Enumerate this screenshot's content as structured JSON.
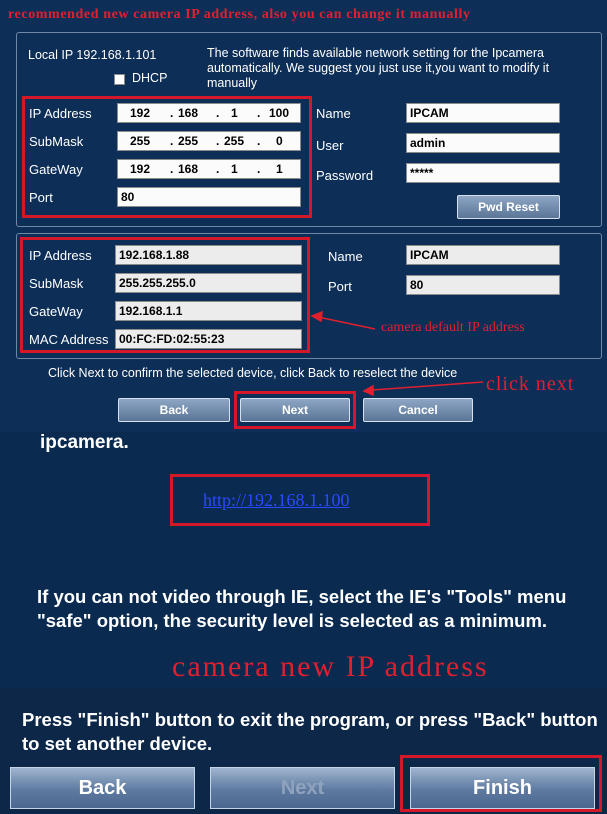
{
  "annotations": {
    "recommended": "recommended new camera IP address, also you can change it manually",
    "default_ip": "camera default IP address",
    "click_next": "click next",
    "new_ip": "camera new IP address"
  },
  "network": {
    "local_ip": "Local IP 192.168.1.101",
    "dhcp_label": "DHCP",
    "hint": "The software finds available network setting for the Ipcamera automatically. We suggest you just use it,you want to modify it manually"
  },
  "new_settings": {
    "ip_label": "IP Address",
    "ip": [
      "192",
      "168",
      "1",
      "100"
    ],
    "mask_label": "SubMask",
    "mask": [
      "255",
      "255",
      "255",
      "0"
    ],
    "gateway_label": "GateWay",
    "gateway": [
      "192",
      "168",
      "1",
      "1"
    ],
    "port_label": "Port",
    "port": "80",
    "name_label": "Name",
    "name": "IPCAM",
    "user_label": "User",
    "user": "admin",
    "password_label": "Password",
    "password": "*****",
    "pwd_reset": "Pwd Reset"
  },
  "default_settings": {
    "ip_label": "IP Address",
    "ip": "192.168.1.88",
    "mask_label": "SubMask",
    "mask": "255.255.255.0",
    "gateway_label": "GateWay",
    "gateway": "192.168.1.1",
    "mac_label": "MAC Address",
    "mac": "00:FC:FD:02:55:23",
    "name_label": "Name",
    "name": "IPCAM",
    "port_label": "Port",
    "port": "80"
  },
  "wizard": {
    "instruction": "Click Next to confirm the selected device, click Back to reselect the device",
    "back": "Back",
    "next": "Next",
    "cancel": "Cancel"
  },
  "finish_page": {
    "heading": "ipcamera.",
    "link": "http://192.168.1.100",
    "ie_note": "If you can not video through IE, select the IE's \"Tools\" menu \"safe\" option, the security level is selected as a minimum.",
    "finish_note": "Press \"Finish\" button to exit the program, or press \"Back\" button to set another device.",
    "back": "Back",
    "next": "Next",
    "finish": "Finish"
  }
}
